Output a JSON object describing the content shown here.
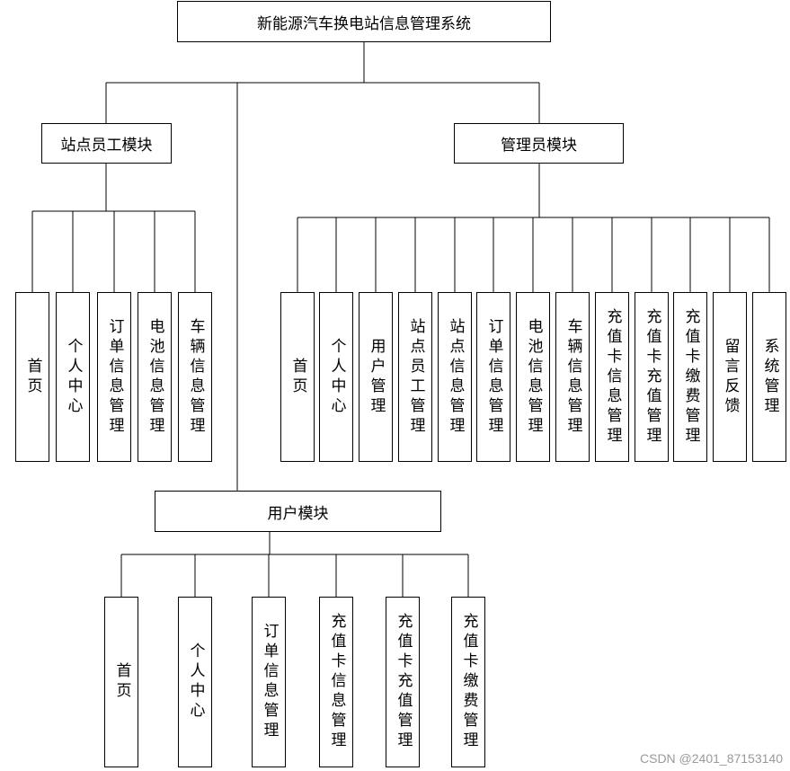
{
  "root": {
    "label": "新能源汽车换电站信息管理系统"
  },
  "modules": {
    "staff": {
      "label": "站点员工模块",
      "items": [
        "首页",
        "个人中心",
        "订单信息管理",
        "电池信息管理",
        "车辆信息管理"
      ]
    },
    "admin": {
      "label": "管理员模块",
      "items": [
        "首页",
        "个人中心",
        "用户管理",
        "站点员工管理",
        "站点信息管理",
        "订单信息管理",
        "电池信息管理",
        "车辆信息管理",
        "充值卡信息管理",
        "充值卡充值管理",
        "充值卡缴费管理",
        "留言反馈",
        "系统管理"
      ]
    },
    "user": {
      "label": "用户模块",
      "items": [
        "首页",
        "个人中心",
        "订单信息管理",
        "充值卡信息管理",
        "充值卡充值管理",
        "充值卡缴费管理"
      ]
    }
  },
  "watermark": "CSDN @2401_87153140"
}
